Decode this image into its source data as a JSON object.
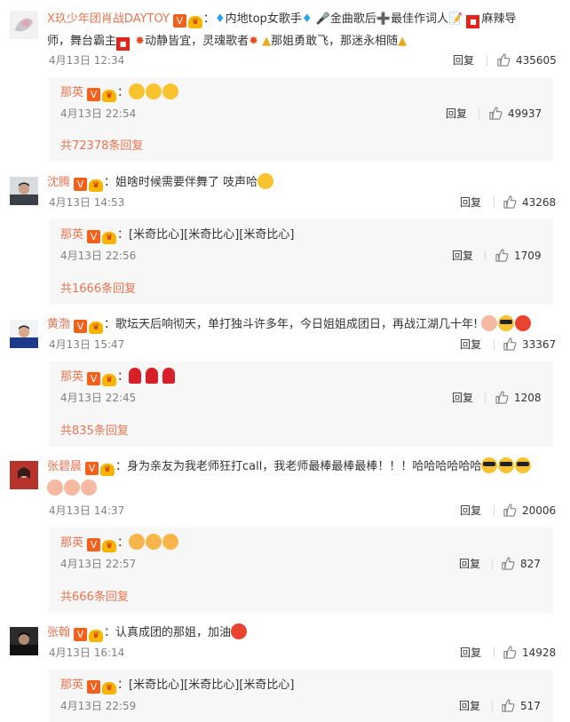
{
  "icons": {
    "like": "thumbs-up-icon",
    "verified": "verified-v-icon",
    "vip": "crown-vip-icon"
  },
  "comments": [
    {
      "user": "X玖少年团肖战DAYTOY",
      "text_parts": [
        "内地top女歌手",
        "金曲歌后",
        "最佳作词人",
        "麻辣导",
        "师，舞台霸主",
        "动静皆宜，灵魂歌者",
        "那姐勇敢飞，那迷永相随"
      ],
      "time": "4月13日 12:34",
      "reply": "回复",
      "likes": "435605",
      "sub": {
        "user": "那英",
        "time": "4月13日 22:54",
        "reply": "回复",
        "likes": "49937"
      },
      "more": "共72378条回复"
    },
    {
      "user": "沈腾",
      "text": "姐啥时候需要伴舞了 吱声哈",
      "time": "4月13日 14:53",
      "reply": "回复",
      "likes": "43268",
      "sub": {
        "user": "那英",
        "text": "[米奇比心][米奇比心][米奇比心]",
        "time": "4月13日 22:56",
        "reply": "回复",
        "likes": "1709"
      },
      "more": "共1666条回复"
    },
    {
      "user": "黄渤",
      "text": "歌坛天后响彻天，单打独斗许多年，今日姐姐成团日，再战江湖几十年!",
      "time": "4月13日 15:47",
      "reply": "回复",
      "likes": "33367",
      "sub": {
        "user": "那英",
        "time": "4月13日 22:45",
        "reply": "回复",
        "likes": "1208"
      },
      "more": "共835条回复"
    },
    {
      "user": "张碧晨",
      "text": "身为亲友为我老师狂打call，我老师最棒最棒最棒！！！哈哈哈哈哈哈",
      "time": "4月13日 14:37",
      "reply": "回复",
      "likes": "20006",
      "sub": {
        "user": "那英",
        "time": "4月13日 22:57",
        "reply": "回复",
        "likes": "827"
      },
      "more": "共666条回复"
    },
    {
      "user": "张翰",
      "text": "认真成团的那姐，加油",
      "time": "4月13日 16:14",
      "reply": "回复",
      "likes": "14928",
      "sub": {
        "user": "那英",
        "text": "[米奇比心][米奇比心][米奇比心]",
        "time": "4月13日 22:59",
        "reply": "回复",
        "likes": "517"
      }
    }
  ]
}
